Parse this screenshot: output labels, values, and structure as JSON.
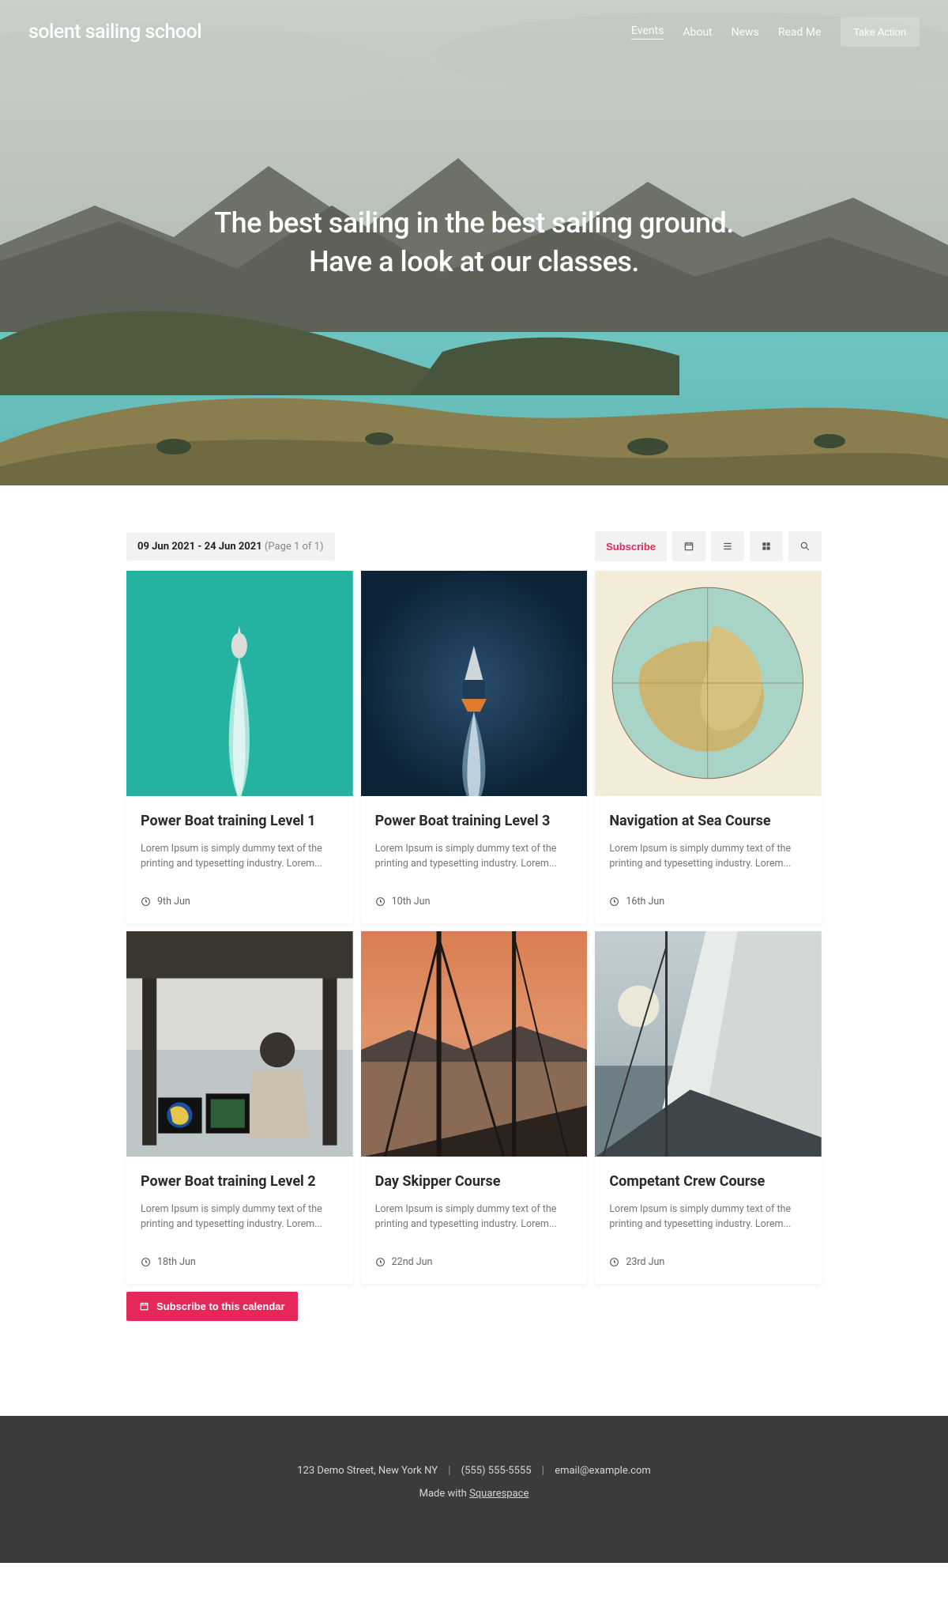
{
  "site": {
    "title": "solent sailing school"
  },
  "nav": {
    "items": [
      {
        "label": "Events",
        "active": true
      },
      {
        "label": "About"
      },
      {
        "label": "News"
      },
      {
        "label": "Read Me"
      }
    ],
    "cta": "Take Action"
  },
  "hero": {
    "heading": "The best sailing in the best sailing ground. Have a look at our classes."
  },
  "toolbar": {
    "from": "09 Jun 2021",
    "to": "24 Jun 2021",
    "page": "(Page 1 of 1)",
    "subscribe": "Subscribe"
  },
  "events": [
    {
      "title": "Power Boat training Level 1",
      "desc": "Lorem Ipsum is simply dummy text of the printing and typesetting industry. Lorem...",
      "date": "9th Jun"
    },
    {
      "title": "Power Boat training Level 3",
      "desc": "Lorem Ipsum is simply dummy text of the printing and typesetting industry. Lorem...",
      "date": "10th Jun"
    },
    {
      "title": "Navigation at Sea Course",
      "desc": "Lorem Ipsum is simply dummy text of the printing and typesetting industry. Lorem...",
      "date": "16th Jun"
    },
    {
      "title": "Power Boat training Level 2",
      "desc": "Lorem Ipsum is simply dummy text of the printing and typesetting industry. Lorem...",
      "date": "18th Jun"
    },
    {
      "title": "Day Skipper Course",
      "desc": "Lorem Ipsum is simply dummy text of the printing and typesetting industry. Lorem...",
      "date": "22nd Jun"
    },
    {
      "title": "Competant Crew Course",
      "desc": "Lorem Ipsum is simply dummy text of the printing and typesetting industry. Lorem...",
      "date": "23rd Jun"
    }
  ],
  "subscribe_calendar": "Subscribe to this calendar",
  "footer": {
    "address": "123 Demo Street, New York NY",
    "phone": "(555) 555-5555",
    "email": "email@example.com",
    "madewith": "Made with ",
    "platform": "Squarespace"
  }
}
